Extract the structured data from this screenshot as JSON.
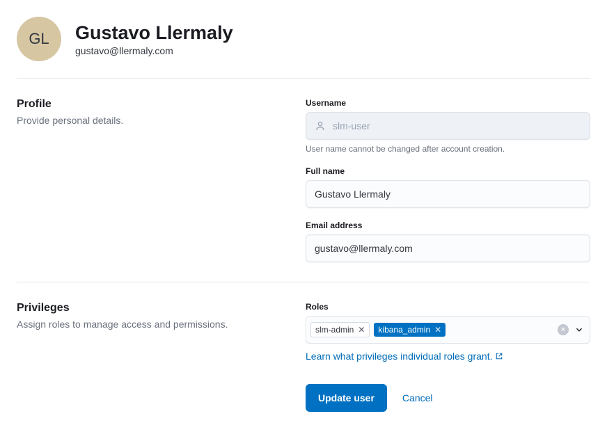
{
  "header": {
    "initials": "GL",
    "name": "Gustavo Llermaly",
    "email": "gustavo@llermaly.com"
  },
  "profile": {
    "title": "Profile",
    "description": "Provide personal details.",
    "username_label": "Username",
    "username_value": "slm-user",
    "username_help": "User name cannot be changed after account creation.",
    "fullname_label": "Full name",
    "fullname_value": "Gustavo Llermaly",
    "email_label": "Email address",
    "email_value": "gustavo@llermaly.com"
  },
  "privileges": {
    "title": "Privileges",
    "description": "Assign roles to manage access and permissions.",
    "roles_label": "Roles",
    "roles": [
      {
        "name": "slm-admin",
        "style": "light"
      },
      {
        "name": "kibana_admin",
        "style": "blue"
      }
    ],
    "learn_link": "Learn what privileges individual roles grant."
  },
  "actions": {
    "update": "Update user",
    "cancel": "Cancel"
  }
}
